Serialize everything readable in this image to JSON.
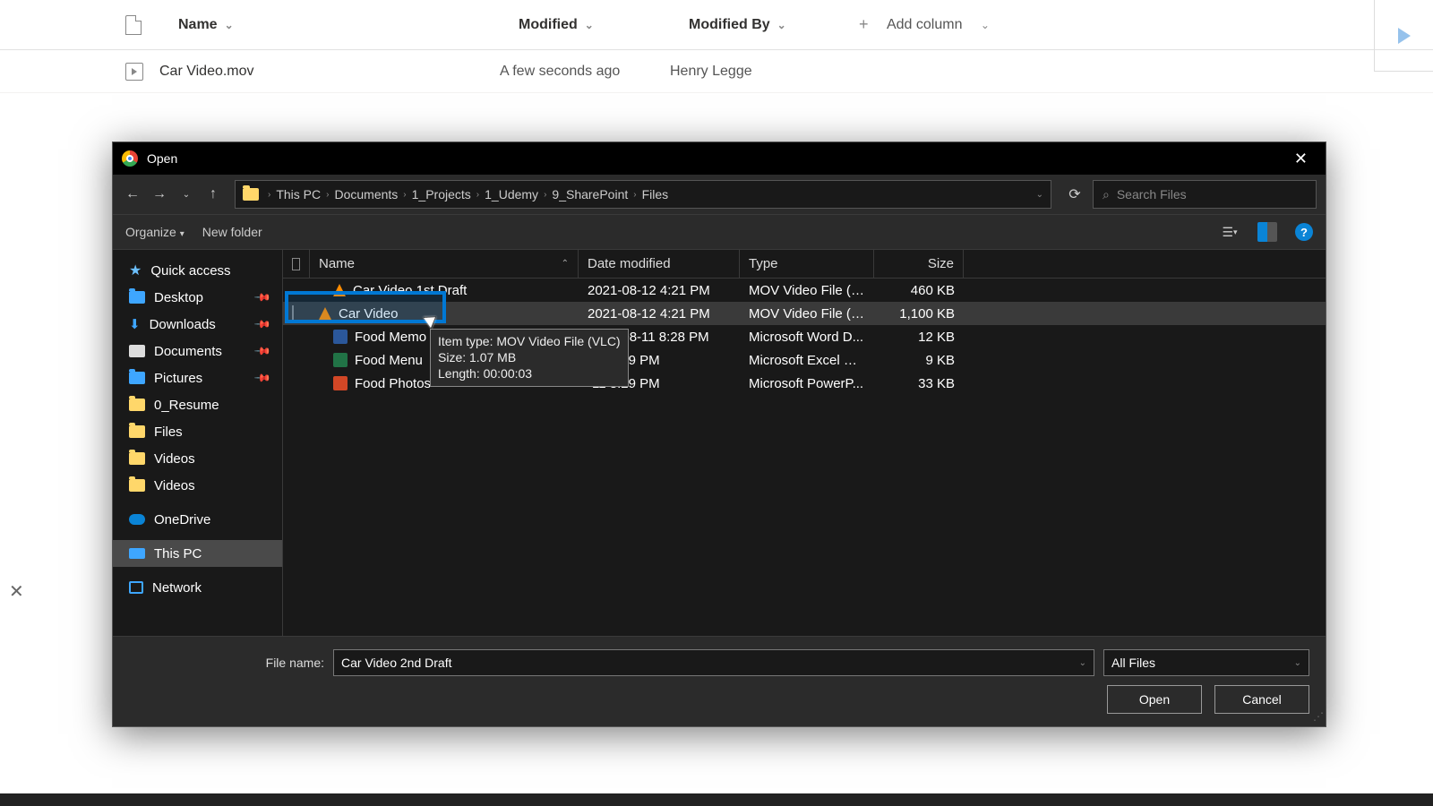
{
  "sharepoint": {
    "columns": {
      "name": "Name",
      "modified": "Modified",
      "modifiedBy": "Modified By",
      "addColumn": "Add column"
    },
    "row": {
      "name": "Car Video.mov",
      "modified": "A few seconds ago",
      "modifiedBy": "Henry Legge"
    }
  },
  "dialog": {
    "title": "Open",
    "breadcrumb": [
      "This PC",
      "Documents",
      "1_Projects",
      "1_Udemy",
      "9_SharePoint",
      "Files"
    ],
    "searchPlaceholder": "Search Files",
    "toolbar": {
      "organize": "Organize",
      "newFolder": "New folder"
    },
    "sidebar": {
      "quickAccess": "Quick access",
      "items": [
        {
          "label": "Desktop",
          "pinned": true
        },
        {
          "label": "Downloads",
          "pinned": true
        },
        {
          "label": "Documents",
          "pinned": true
        },
        {
          "label": "Pictures",
          "pinned": true
        },
        {
          "label": "0_Resume",
          "pinned": false
        },
        {
          "label": "Files",
          "pinned": false
        },
        {
          "label": "Videos",
          "pinned": false
        },
        {
          "label": "Videos",
          "pinned": false
        }
      ],
      "onedrive": "OneDrive",
      "thispc": "This PC",
      "network": "Network"
    },
    "columns": {
      "name": "Name",
      "date": "Date modified",
      "type": "Type",
      "size": "Size"
    },
    "files": [
      {
        "name": "Car Video 1st Draft",
        "icon": "vlc",
        "date": "2021-08-12 4:21 PM",
        "type": "MOV Video File (V...",
        "size": "460 KB"
      },
      {
        "name": "Car Video",
        "icon": "vlc",
        "date": "2021-08-12 4:21 PM",
        "type": "MOV Video File (V...",
        "size": "1,100 KB"
      },
      {
        "name": "Food Memo",
        "icon": "word",
        "date": "2021-08-11 8:28 PM",
        "type": "Microsoft Word D...",
        "size": "12 KB"
      },
      {
        "name": "Food Menu",
        "icon": "excel",
        "date": "-11 8:29 PM",
        "type": "Microsoft Excel W...",
        "size": "9 KB"
      },
      {
        "name": "Food Photos",
        "icon": "ppt",
        "date": "-11 8:29 PM",
        "type": "Microsoft PowerP...",
        "size": "33 KB"
      }
    ],
    "tooltip": {
      "line1": "Item type: MOV Video File (VLC)",
      "line2": "Size: 1.07 MB",
      "line3": "Length: 00:00:03"
    },
    "fileNameLabel": "File name:",
    "fileNameValue": "Car Video 2nd Draft",
    "filterValue": "All Files",
    "openBtn": "Open",
    "cancelBtn": "Cancel"
  }
}
